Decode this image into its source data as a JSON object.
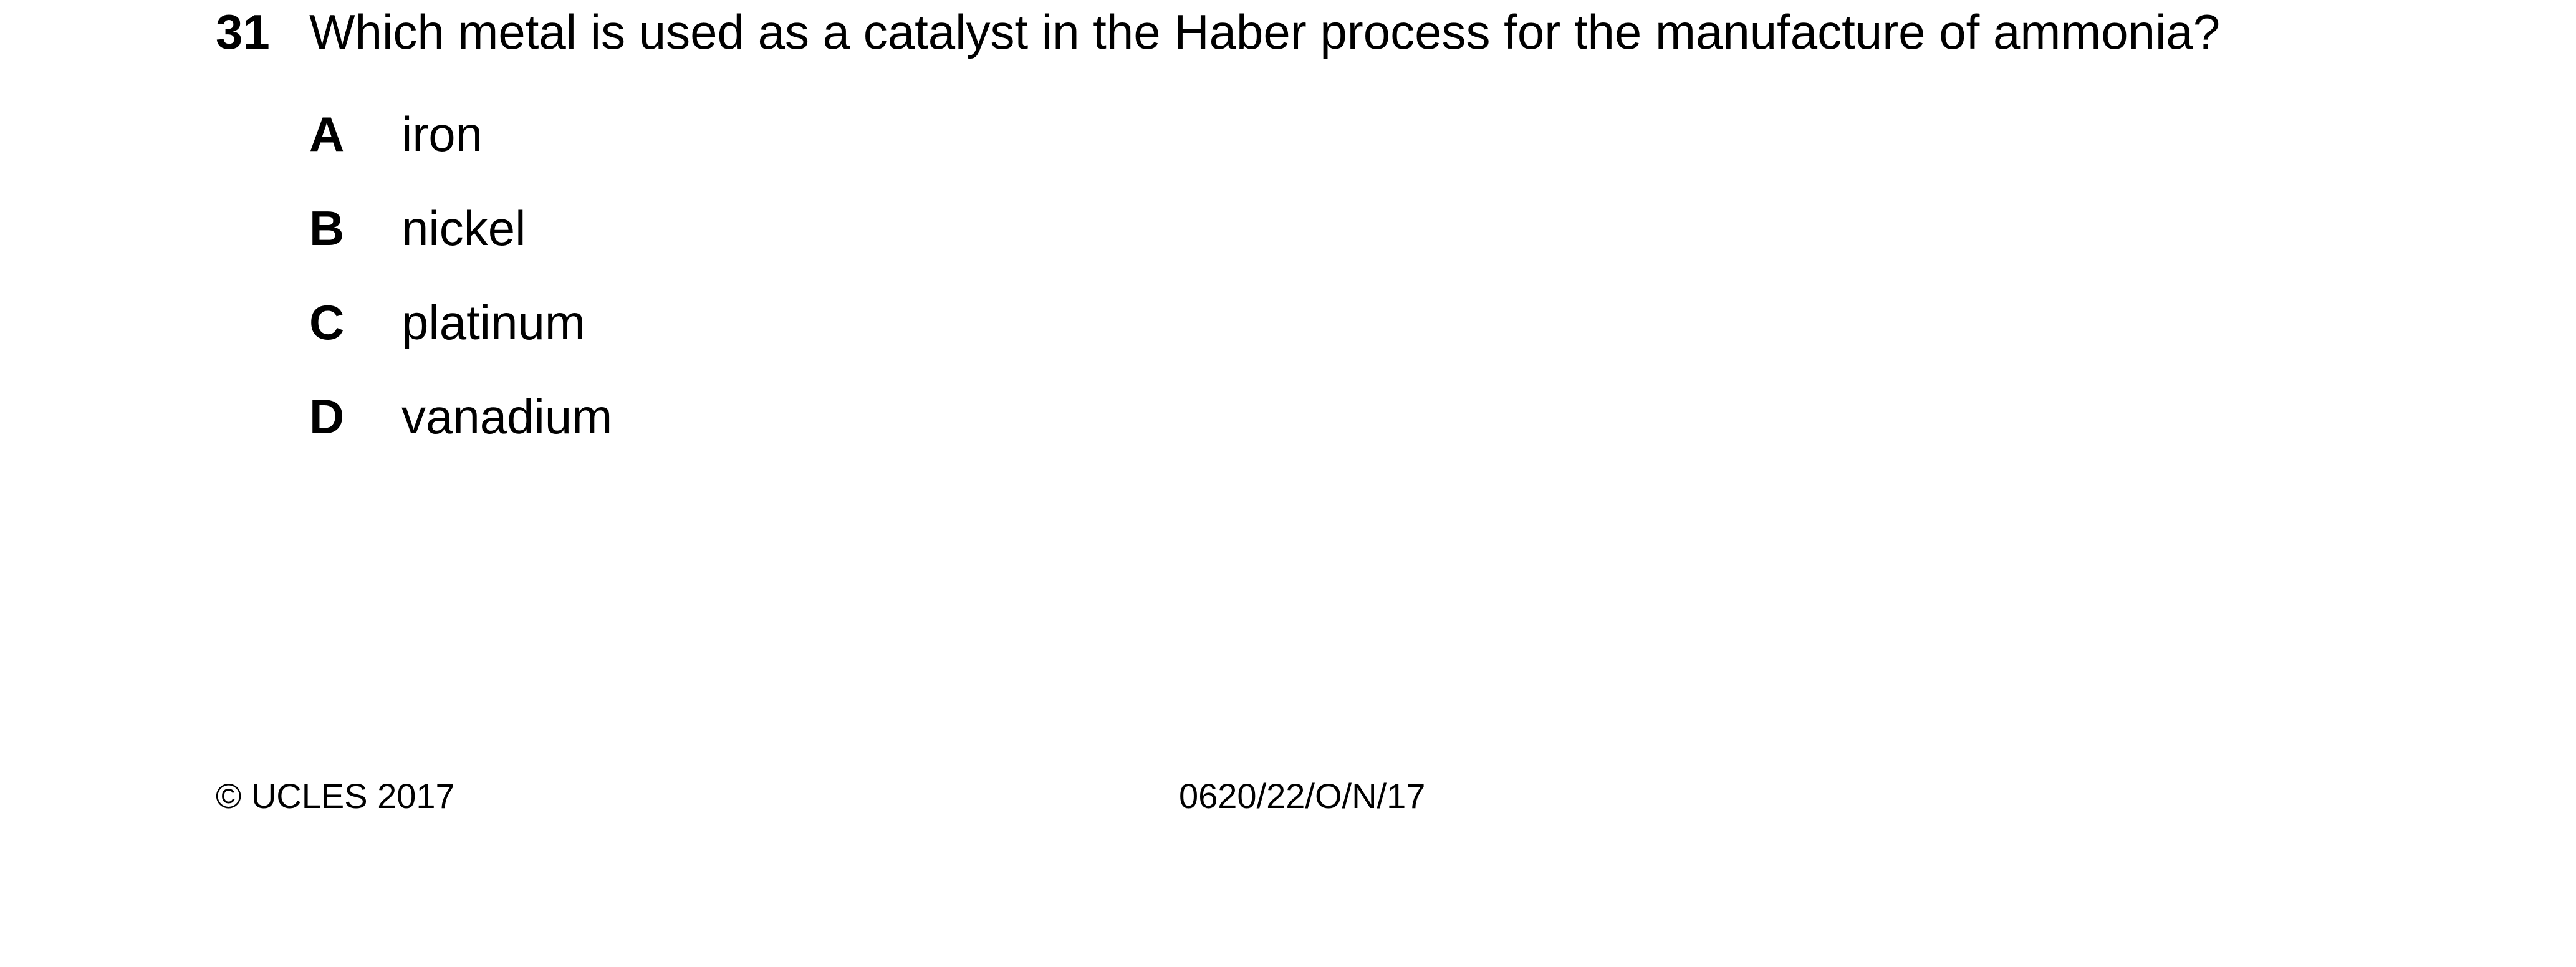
{
  "question": {
    "number": "31",
    "text": "Which metal is used as a catalyst in the Haber process for the manufacture of ammonia?"
  },
  "options": [
    {
      "letter": "A",
      "text": "iron"
    },
    {
      "letter": "B",
      "text": "nickel"
    },
    {
      "letter": "C",
      "text": "platinum"
    },
    {
      "letter": "D",
      "text": "vanadium"
    }
  ],
  "footer": {
    "copyright": "© UCLES 2017",
    "paper_code": "0620/22/O/N/17"
  }
}
